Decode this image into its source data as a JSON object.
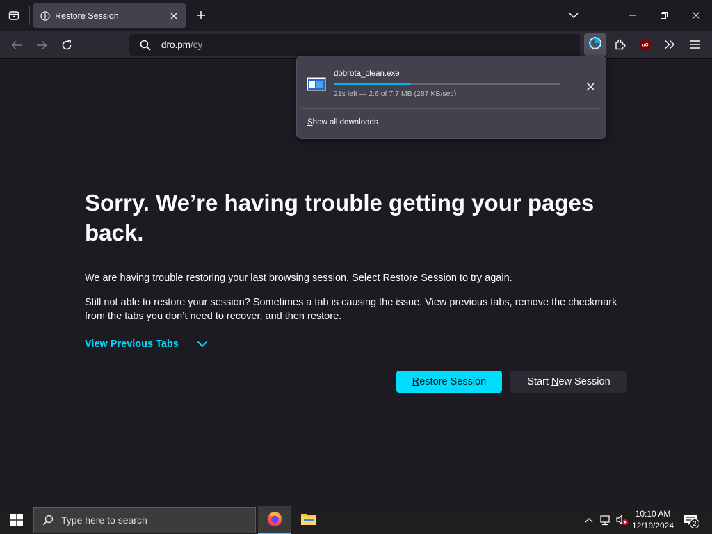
{
  "browser": {
    "tab": {
      "title": "Restore Session"
    },
    "url": {
      "host": "dro.pm",
      "path": "/cy"
    }
  },
  "downloads": {
    "file_name": "dobrota_clean.exe",
    "progress": 0.34,
    "status": "21s left — 2.6 of 7.7 MB (287 KB/sec)",
    "show_all_prefix": "S",
    "show_all_rest": "how all downloads"
  },
  "page": {
    "headline": "Sorry. We’re having trouble getting your pages back.",
    "paragraph1": "We are having trouble restoring your last browsing session. Select Restore Session to try again.",
    "paragraph2": "Still not able to restore your session? Sometimes a tab is causing the issue. View previous tabs, remove the checkmark from the tabs you don’t need to recover, and then restore.",
    "view_previous_tabs": "View Previous Tabs",
    "restore_button": {
      "prefix": "R",
      "rest": "estore Session"
    },
    "new_session_button": {
      "before": "Start ",
      "key": "N",
      "after": "ew Session"
    }
  },
  "taskbar": {
    "search_placeholder": "Type here to search",
    "time": "10:10 AM",
    "date": "12/19/2024",
    "notification_count": "2"
  },
  "colors": {
    "accent": "#00ddff",
    "progress": "#00b3f4",
    "ublock": "#800000"
  }
}
